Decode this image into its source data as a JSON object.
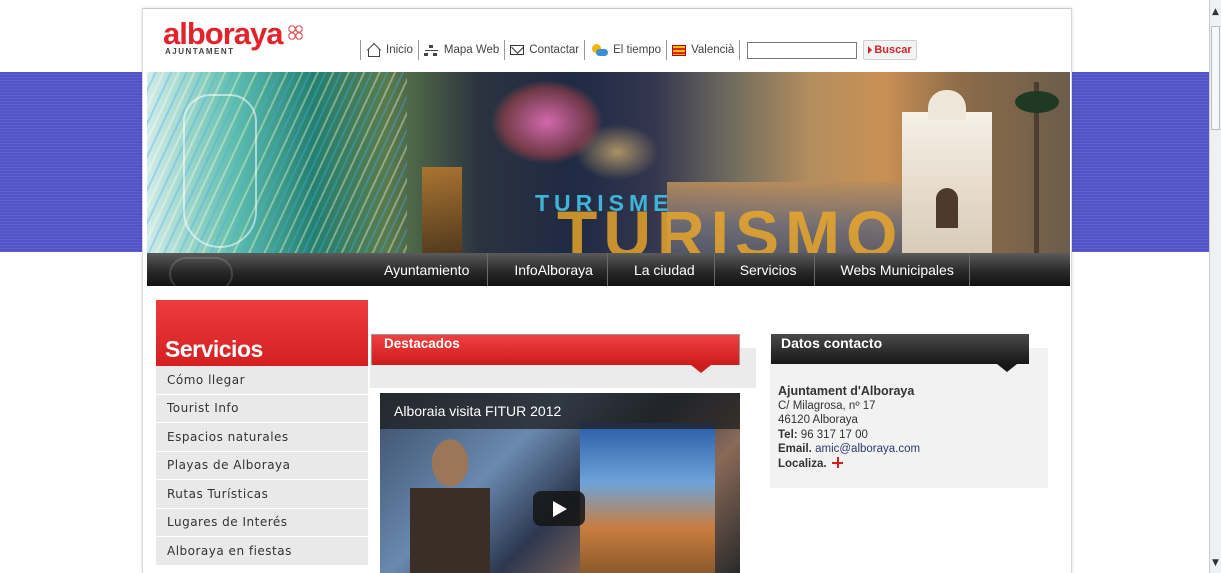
{
  "header": {
    "logo_text": "alboraya",
    "logo_sub": "AJUNTAMENT"
  },
  "topnav": {
    "items": [
      {
        "label": "Inicio",
        "icon": "home-icon"
      },
      {
        "label": "Mapa Web",
        "icon": "sitemap-icon"
      },
      {
        "label": "Contactar",
        "icon": "mail-icon"
      },
      {
        "label": "El tiempo",
        "icon": "weather-icon"
      },
      {
        "label": "Valencià",
        "icon": "flag-icon"
      }
    ],
    "search_value": "",
    "search_button": "Buscar"
  },
  "banner": {
    "small_text": "TURISME",
    "big_text": "TURISMO"
  },
  "mainnav": {
    "items": [
      "Ayuntamiento",
      "InfoAlboraya",
      "La ciudad",
      "Servicios",
      "Webs Municipales"
    ]
  },
  "sidebar": {
    "title": "Servicios",
    "items": [
      "Cómo llegar",
      "Tourist Info",
      "Espacios naturales",
      "Playas de Alboraya",
      "Rutas Turísticas",
      "Lugares de Interés",
      "Alboraya en fiestas"
    ]
  },
  "destacados": {
    "title": "Destacados",
    "video_title": "Alboraia visita FITUR 2012"
  },
  "contact": {
    "title": "Datos contacto",
    "org": "Ajuntament d'Alboraya",
    "address": "C/ Milagrosa, nº 17",
    "city": "46120 Alboraya",
    "tel_label": "Tel:",
    "tel": "96 317 17 00",
    "email_label": "Email.",
    "email": "amic@alboraya.com",
    "locate_label": "Localiza."
  },
  "colors": {
    "brand_red": "#e2232a",
    "band_blue": "#5353c8",
    "nav_dark": "#2a2a2a"
  }
}
